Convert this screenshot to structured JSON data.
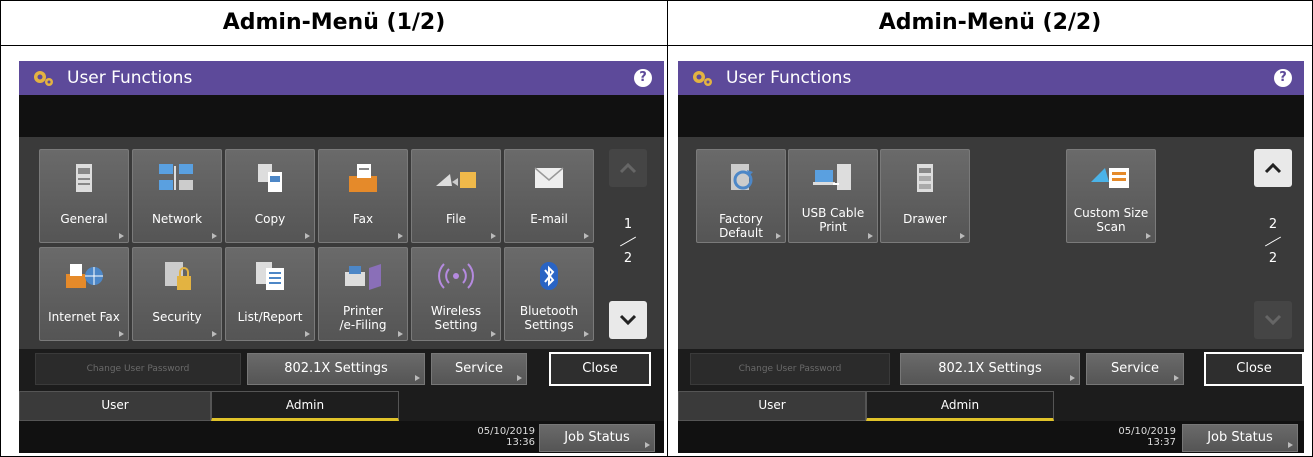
{
  "panels": [
    {
      "heading": "Admin-Menü (1/2)",
      "title": "User Functions",
      "help": "?",
      "tiles": [
        {
          "label": "General",
          "icon": "general-icon"
        },
        {
          "label": "Network",
          "icon": "network-icon"
        },
        {
          "label": "Copy",
          "icon": "copy-icon"
        },
        {
          "label": "Fax",
          "icon": "fax-icon"
        },
        {
          "label": "File",
          "icon": "file-icon"
        },
        {
          "label": "E-mail",
          "icon": "email-icon"
        },
        {
          "label": "Internet Fax",
          "icon": "internet-fax-icon"
        },
        {
          "label": "Security",
          "icon": "security-icon"
        },
        {
          "label": "List/Report",
          "icon": "list-report-icon"
        },
        {
          "label": "Printer\n/e-Filing",
          "icon": "printer-efiling-icon"
        },
        {
          "label": "Wireless\nSetting",
          "icon": "wireless-icon"
        },
        {
          "label": "Bluetooth\nSettings",
          "icon": "bluetooth-icon"
        }
      ],
      "page_num": "1",
      "page_total": "2",
      "up_enabled": false,
      "down_enabled": true,
      "bottom": {
        "change_password": "Change User Password",
        "dot1x": "802.1X Settings",
        "service": "Service",
        "close": "Close"
      },
      "tabs": {
        "user": "User",
        "admin": "Admin"
      },
      "date": "05/10/2019",
      "time": "13:36",
      "job_status": "Job Status"
    },
    {
      "heading": "Admin-Menü (2/2)",
      "title": "User Functions",
      "help": "?",
      "tiles": [
        {
          "label": "Factory Default",
          "icon": "factory-default-icon"
        },
        {
          "label": "USB Cable\nPrint",
          "icon": "usb-cable-print-icon"
        },
        {
          "label": "Drawer",
          "icon": "drawer-icon"
        },
        {
          "label": "Custom Size\nScan",
          "icon": "custom-size-scan-icon"
        }
      ],
      "page_num": "2",
      "page_total": "2",
      "up_enabled": true,
      "down_enabled": false,
      "bottom": {
        "change_password": "Change User Password",
        "dot1x": "802.1X Settings",
        "service": "Service",
        "close": "Close"
      },
      "tabs": {
        "user": "User",
        "admin": "Admin"
      },
      "date": "05/10/2019",
      "time": "13:37",
      "job_status": "Job Status"
    }
  ],
  "colors": {
    "title_bar": "#5d4a9a",
    "active_tab_underline": "#e0c32a",
    "screen_bg": "#1c1c1c"
  }
}
